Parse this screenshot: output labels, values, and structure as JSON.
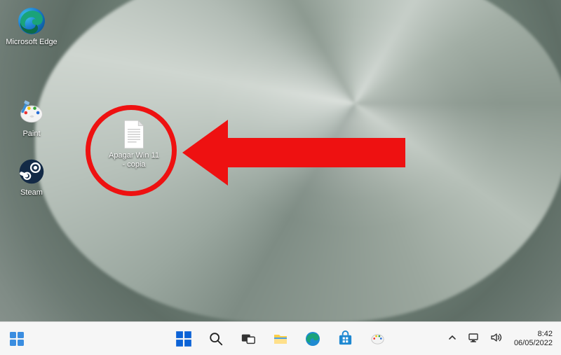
{
  "desktop": {
    "icons": [
      {
        "id": "edge",
        "label": "Microsoft Edge"
      },
      {
        "id": "paint",
        "label": "Paint"
      },
      {
        "id": "steam",
        "label": "Steam"
      }
    ],
    "file": {
      "label": "Apagar Win 11 - copia"
    }
  },
  "taskbar": {
    "buttons": [
      {
        "id": "start",
        "name": "start-button"
      },
      {
        "id": "search",
        "name": "search-button"
      },
      {
        "id": "taskview",
        "name": "task-view-button"
      },
      {
        "id": "explorer",
        "name": "file-explorer-button"
      },
      {
        "id": "edge",
        "name": "edge-button"
      },
      {
        "id": "store",
        "name": "microsoft-store-button"
      },
      {
        "id": "paint",
        "name": "paint-button"
      }
    ],
    "tray": {
      "time": "8:42",
      "date": "06/05/2022"
    }
  },
  "annotation": {
    "color": "#e11"
  }
}
